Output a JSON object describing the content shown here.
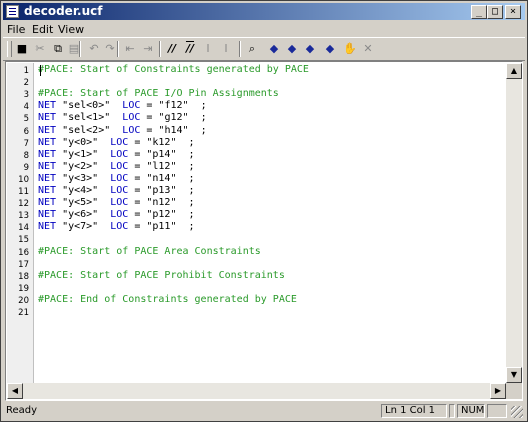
{
  "window": {
    "title": "decoder.ucf",
    "controls": [
      "_",
      "□",
      "×"
    ]
  },
  "menu": [
    "File",
    "Edit",
    "View"
  ],
  "toolbar": {
    "buttons": [
      {
        "name": "save-icon",
        "glyph": "■",
        "state": "enabled"
      },
      {
        "name": "cut-icon",
        "glyph": "✂",
        "state": "disabled"
      },
      {
        "name": "copy-icon",
        "glyph": "⧉",
        "state": "enabled"
      },
      {
        "name": "paste-icon",
        "glyph": "▤",
        "state": "disabled"
      },
      {
        "name": "undo-icon",
        "glyph": "↶",
        "state": "disabled"
      },
      {
        "name": "redo-icon",
        "glyph": "↷",
        "state": "disabled"
      },
      {
        "name": "outdent-icon",
        "glyph": "⇤",
        "state": "disabled"
      },
      {
        "name": "indent-icon",
        "glyph": "⇥",
        "state": "disabled"
      },
      {
        "name": "comment-icon",
        "glyph": "//",
        "state": "enabled"
      },
      {
        "name": "uncomment-icon",
        "glyph": "//",
        "state": "enabled"
      },
      {
        "name": "italic-icon",
        "glyph": "I",
        "state": "disabled"
      },
      {
        "name": "format-icon",
        "glyph": "I",
        "state": "disabled"
      },
      {
        "name": "find-icon",
        "glyph": "⌕",
        "state": "enabled"
      },
      {
        "name": "bookmark-toggle-icon",
        "glyph": "◆",
        "state": "enabled"
      },
      {
        "name": "bookmark-next-icon",
        "glyph": "◆",
        "state": "enabled"
      },
      {
        "name": "bookmark-prev-icon",
        "glyph": "◆",
        "state": "enabled"
      },
      {
        "name": "bookmark-clear-icon",
        "glyph": "◆",
        "state": "disabled"
      },
      {
        "name": "hand-icon",
        "glyph": "✋",
        "state": "disabled"
      },
      {
        "name": "tools-icon",
        "glyph": "✕",
        "state": "disabled"
      }
    ]
  },
  "editor": {
    "lines": [
      {
        "n": "1",
        "parts": [
          {
            "t": "#PACE: Start of Constraints generated by PACE",
            "c": "cmt"
          }
        ]
      },
      {
        "n": "2",
        "parts": []
      },
      {
        "n": "3",
        "parts": [
          {
            "t": "#PACE: Start of PACE I/O Pin Assignments",
            "c": "cmt"
          }
        ]
      },
      {
        "n": "4",
        "parts": [
          {
            "t": "NET",
            "c": "kw"
          },
          {
            "t": " \"sel<0>\"  ",
            "c": ""
          },
          {
            "t": "LOC",
            "c": "kw"
          },
          {
            "t": " = \"f12\"  ;",
            "c": ""
          }
        ]
      },
      {
        "n": "5",
        "parts": [
          {
            "t": "NET",
            "c": "kw"
          },
          {
            "t": " \"sel<1>\"  ",
            "c": ""
          },
          {
            "t": "LOC",
            "c": "kw"
          },
          {
            "t": " = \"g12\"  ;",
            "c": ""
          }
        ]
      },
      {
        "n": "6",
        "parts": [
          {
            "t": "NET",
            "c": "kw"
          },
          {
            "t": " \"sel<2>\"  ",
            "c": ""
          },
          {
            "t": "LOC",
            "c": "kw"
          },
          {
            "t": " = \"h14\"  ;",
            "c": ""
          }
        ]
      },
      {
        "n": "7",
        "parts": [
          {
            "t": "NET",
            "c": "kw"
          },
          {
            "t": " \"y<0>\"  ",
            "c": ""
          },
          {
            "t": "LOC",
            "c": "kw"
          },
          {
            "t": " = \"k12\"  ;",
            "c": ""
          }
        ]
      },
      {
        "n": "8",
        "parts": [
          {
            "t": "NET",
            "c": "kw"
          },
          {
            "t": " \"y<1>\"  ",
            "c": ""
          },
          {
            "t": "LOC",
            "c": "kw"
          },
          {
            "t": " = \"p14\"  ;",
            "c": ""
          }
        ]
      },
      {
        "n": "9",
        "parts": [
          {
            "t": "NET",
            "c": "kw"
          },
          {
            "t": " \"y<2>\"  ",
            "c": ""
          },
          {
            "t": "LOC",
            "c": "kw"
          },
          {
            "t": " = \"l12\"  ;",
            "c": ""
          }
        ]
      },
      {
        "n": "10",
        "parts": [
          {
            "t": "NET",
            "c": "kw"
          },
          {
            "t": " \"y<3>\"  ",
            "c": ""
          },
          {
            "t": "LOC",
            "c": "kw"
          },
          {
            "t": " = \"n14\"  ;",
            "c": ""
          }
        ]
      },
      {
        "n": "11",
        "parts": [
          {
            "t": "NET",
            "c": "kw"
          },
          {
            "t": " \"y<4>\"  ",
            "c": ""
          },
          {
            "t": "LOC",
            "c": "kw"
          },
          {
            "t": " = \"p13\"  ;",
            "c": ""
          }
        ]
      },
      {
        "n": "12",
        "parts": [
          {
            "t": "NET",
            "c": "kw"
          },
          {
            "t": " \"y<5>\"  ",
            "c": ""
          },
          {
            "t": "LOC",
            "c": "kw"
          },
          {
            "t": " = \"n12\"  ;",
            "c": ""
          }
        ]
      },
      {
        "n": "13",
        "parts": [
          {
            "t": "NET",
            "c": "kw"
          },
          {
            "t": " \"y<6>\"  ",
            "c": ""
          },
          {
            "t": "LOC",
            "c": "kw"
          },
          {
            "t": " = \"p12\"  ;",
            "c": ""
          }
        ]
      },
      {
        "n": "14",
        "parts": [
          {
            "t": "NET",
            "c": "kw"
          },
          {
            "t": " \"y<7>\"  ",
            "c": ""
          },
          {
            "t": "LOC",
            "c": "kw"
          },
          {
            "t": " = \"p11\"  ;",
            "c": ""
          }
        ]
      },
      {
        "n": "15",
        "parts": []
      },
      {
        "n": "16",
        "parts": [
          {
            "t": "#PACE: Start of PACE Area Constraints",
            "c": "cmt"
          }
        ]
      },
      {
        "n": "17",
        "parts": []
      },
      {
        "n": "18",
        "parts": [
          {
            "t": "#PACE: Start of PACE Prohibit Constraints",
            "c": "cmt"
          }
        ]
      },
      {
        "n": "19",
        "parts": []
      },
      {
        "n": "20",
        "parts": [
          {
            "t": "#PACE: End of Constraints generated by PACE",
            "c": "cmt"
          }
        ]
      },
      {
        "n": "21",
        "parts": []
      }
    ]
  },
  "status": {
    "text": "Ready",
    "position": "Ln 1 Col 1",
    "num": "NUM"
  }
}
